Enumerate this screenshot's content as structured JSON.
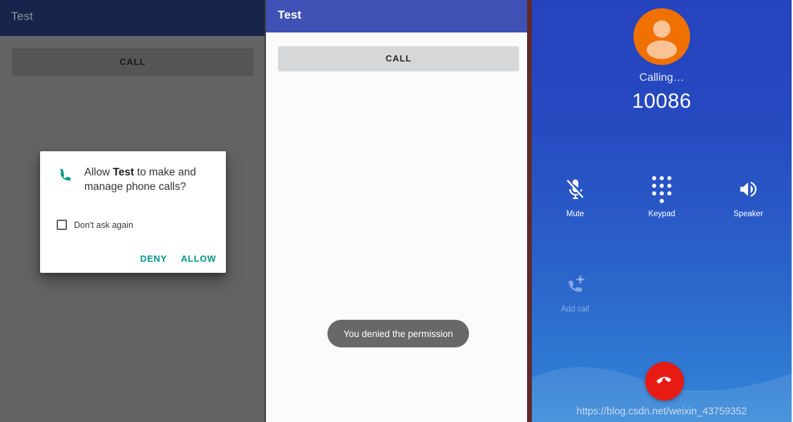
{
  "panels": {
    "left": {
      "name": "permission-dialog-screen",
      "appbar_title": "Test",
      "call_button_label": "CALL",
      "dialog": {
        "icon": "phone-icon",
        "message_prefix": "Allow ",
        "message_app": "Test",
        "message_suffix": " to make and manage phone calls?",
        "checkbox_label": "Don't ask again",
        "deny_label": "DENY",
        "allow_label": "ALLOW",
        "accent_color": "#009688"
      }
    },
    "middle": {
      "name": "permission-denied-screen",
      "appbar_title": "Test",
      "call_button_label": "CALL",
      "toast_message": "You denied the permission",
      "appbar_color": "#3f51b5"
    },
    "right": {
      "name": "in-call-screen",
      "avatar_icon": "person-avatar-icon",
      "avatar_color": "#f07000",
      "status_label": "Calling…",
      "phone_number": "10086",
      "controls": [
        {
          "icon": "mic-off-icon",
          "label": "Mute",
          "disabled": false
        },
        {
          "icon": "dialpad-icon",
          "label": "Keypad",
          "disabled": false
        },
        {
          "icon": "speaker-icon",
          "label": "Speaker",
          "disabled": false
        },
        {
          "icon": "add-call-icon",
          "label": "Add call",
          "disabled": true
        }
      ],
      "end_call_icon": "call-end-icon",
      "end_call_color": "#e81b12",
      "watermark": "https://blog.csdn.net/weixin_43759352",
      "background_top_color": "#2543bd",
      "background_bottom_color": "#3689d8"
    }
  }
}
